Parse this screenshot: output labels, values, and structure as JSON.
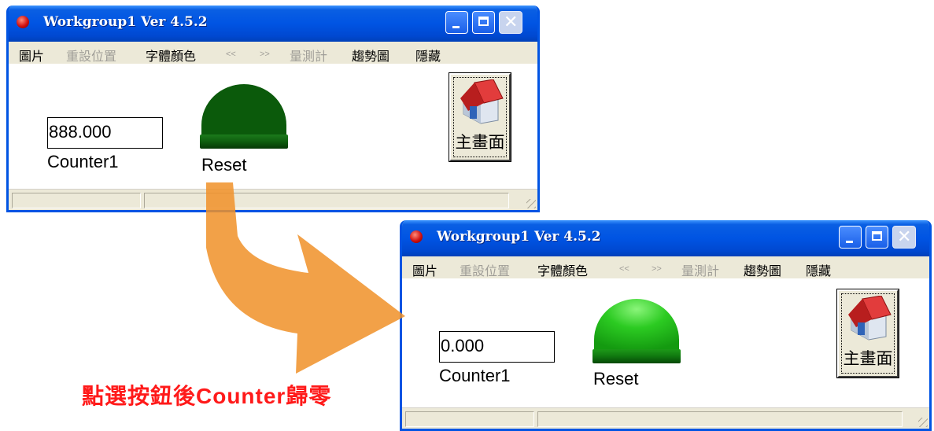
{
  "windows": [
    {
      "title": "Workgroup1 Ver 4.5.2",
      "menu": [
        "圖片",
        "重設位置",
        "字體顏色",
        "<<",
        ">>",
        "量測計",
        "趨勢圖",
        "隱藏"
      ],
      "counter_value": "888.000",
      "counter_label": "Counter1",
      "reset_label": "Reset",
      "reset_state": "off",
      "home_button_label": "主畫面"
    },
    {
      "title": "Workgroup1 Ver 4.5.2",
      "menu": [
        "圖片",
        "重設位置",
        "字體顏色",
        "<<",
        ">>",
        "量測計",
        "趨勢圖",
        "隱藏"
      ],
      "counter_value": "0.000",
      "counter_label": "Counter1",
      "reset_label": "Reset",
      "reset_state": "on",
      "home_button_label": "主畫面"
    }
  ],
  "caption": "點選按鈕後Counter歸零",
  "colors": {
    "titlebar": "#0054e3",
    "reset_off": "#0b5a0b",
    "reset_on": "#22c41a",
    "caption": "#ff1a1a",
    "arrow": "#f0922a"
  },
  "icons": {
    "app": "red-ball-icon",
    "home": "house-icon",
    "arrow": "curved-arrow-icon"
  }
}
